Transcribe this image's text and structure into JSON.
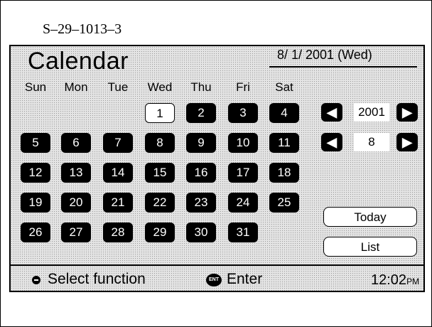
{
  "figure_id": "S–29–1013–3",
  "screen": {
    "title": "Calendar",
    "current_date": "8/ 1/ 2001 (Wed)",
    "weekdays": [
      "Sun",
      "Mon",
      "Tue",
      "Wed",
      "Thu",
      "Fri",
      "Sat"
    ],
    "days": [
      "1",
      "2",
      "3",
      "4",
      "5",
      "6",
      "7",
      "8",
      "9",
      "10",
      "11",
      "12",
      "13",
      "14",
      "15",
      "16",
      "17",
      "18",
      "19",
      "20",
      "21",
      "22",
      "23",
      "24",
      "25",
      "26",
      "27",
      "28",
      "29",
      "30",
      "31"
    ],
    "first_weekday_index": 3,
    "selected_day": "1",
    "year_selector": {
      "prev": "◀",
      "value": "2001",
      "next": "▶"
    },
    "month_selector": {
      "prev": "◀",
      "value": "8",
      "next": "▶"
    },
    "buttons": {
      "today": "Today",
      "list": "List"
    },
    "status": {
      "select_label": "Select function",
      "enter_icon_text": "ENT",
      "enter_label": "Enter",
      "time": "12:02",
      "time_suffix": "PM"
    }
  }
}
